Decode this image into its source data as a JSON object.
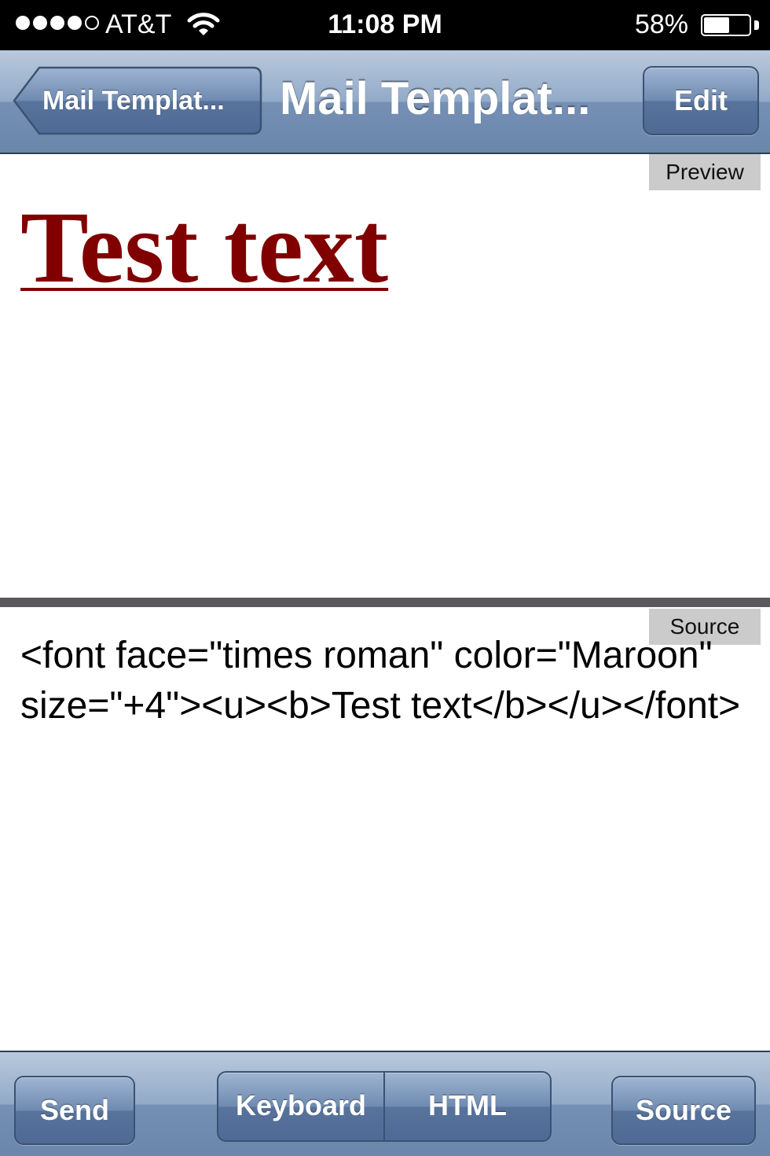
{
  "status_bar": {
    "carrier": "AT&T",
    "time": "11:08 PM",
    "battery_percent": "58%",
    "battery_level": 0.58,
    "signal_bars_filled": 4,
    "signal_bars_total": 5
  },
  "nav_bar": {
    "back_label": "Mail Templat...",
    "title": "Mail Templat...",
    "edit_label": "Edit"
  },
  "preview": {
    "tag": "Preview",
    "text": "Test text",
    "text_color": "#800000"
  },
  "source": {
    "tag": "Source",
    "code": "<font face=\"times roman\" color=\"Maroon\" size=\"+4\"><u><b>Test text</b></u></font>"
  },
  "toolbar": {
    "send_label": "Send",
    "keyboard_label": "Keyboard",
    "html_label": "HTML",
    "source_label": "Source"
  },
  "colors": {
    "bar_blue": "#6b86ab",
    "divider": "#5a585d",
    "tag_gray": "#cbcbcb"
  }
}
